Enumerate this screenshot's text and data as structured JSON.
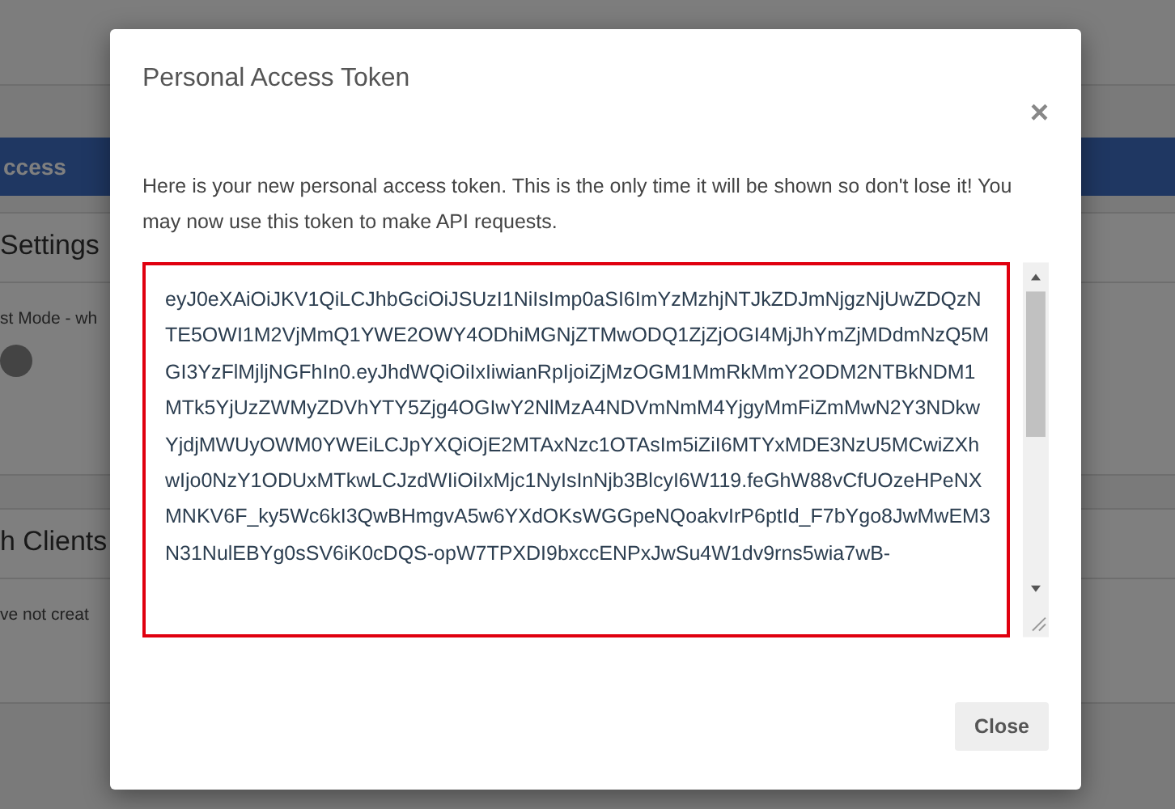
{
  "background": {
    "header_text": "ccess",
    "section_title": "Settings",
    "setting_label": "st Mode - wh",
    "toggle": {
      "on": false
    },
    "clients_title": "h Clients",
    "clients_note": "ve not creat"
  },
  "modal": {
    "title": "Personal Access Token",
    "close_icon": "×",
    "message": "Here is your new personal access token. This is the only time it will be shown so don't lose it! You may now use this token to make API requests.",
    "token": "eyJ0eXAiOiJKV1QiLCJhbGciOiJSUzI1NiIsImp0aSI6ImYzMzhjNTJkZDJmNjgzNjUwZDQzNTE5OWI1M2VjMmQ1YWE2OWY4ODhiMGNjZTMwODQ1ZjZjOGI4MjJhYmZjMDdmNzQ5MGI3YzFlMjljNGFhIn0.eyJhdWQiOiIxIiwianRpIjoiZjMzOGM1MmRkMmY2ODM2NTBkNDM1MTk5YjUzZWMyZDVhYTY5Zjg4OGIwY2NlMzA4NDVmNmM4YjgyMmFiZmMwN2Y3NDkwYjdjMWUyOWM0YWEiLCJpYXQiOjE2MTAxNzc1OTAsIm5iZiI6MTYxMDE3NzU5MCwiZXhwIjo0NzY1ODUxMTkwLCJzdWIiOiIxMjc1NyIsInNjb3BlcyI6W119.feGhW88vCfUOzeHPeNXMNKV6F_ky5Wc6kI3QwBHmgvA5w6YXdOKsWGGpeNQoakvIrP6ptId_F7bYgo8JwMwEM3N31NulEBYg0sSV6iK0cDQS-opW7TPXDI9bxccENPxJwSu4W1dv9rns5wia7wB-",
    "button": "Close"
  }
}
